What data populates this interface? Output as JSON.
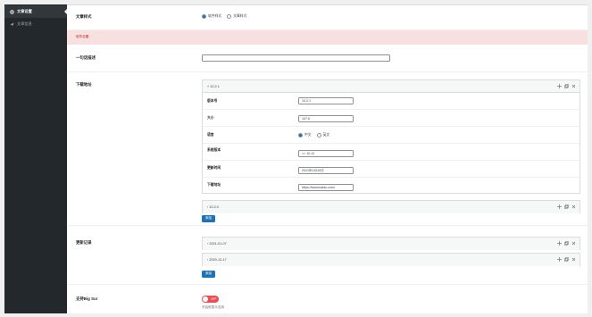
{
  "sidebar": {
    "items": [
      {
        "label": "文章设置",
        "icon": "gear-icon",
        "active": true
      },
      {
        "label": "文章信息",
        "icon": "paper-plane-icon",
        "active": false
      }
    ]
  },
  "main": {
    "article_style": {
      "label": "文章样式",
      "options": [
        {
          "label": "软件样式",
          "selected": true
        },
        {
          "label": "文章样式",
          "selected": false
        }
      ]
    },
    "notice": {
      "text": "软件设置"
    },
    "summary": {
      "label": "一句话描述",
      "value": ""
    },
    "download": {
      "label": "下载地址",
      "panels": [
        {
          "title": "10.2.1",
          "expanded": true,
          "fields": [
            {
              "label": "版本号",
              "type": "input",
              "value": "10.2.1"
            },
            {
              "label": "大小",
              "type": "input",
              "value": "107.6"
            },
            {
              "label": "语言",
              "type": "radio",
              "options": [
                {
                  "label": "中文",
                  "selected": true
                },
                {
                  "label": "英文",
                  "selected": false
                }
              ]
            },
            {
              "label": "系统版本",
              "type": "input",
              "value": ">= 10.12"
            },
            {
              "label": "更新时间",
              "type": "input",
              "value": "2021年1月10日"
            },
            {
              "label": "下载地址",
              "type": "input",
              "value": "https://www.baidu.com/"
            }
          ]
        },
        {
          "title": "10.2.0",
          "expanded": false
        }
      ],
      "add_label": "添加"
    },
    "changelog": {
      "label": "更新记录",
      "panels": [
        {
          "title": "2021-01-07"
        },
        {
          "title": "2020-12-17"
        }
      ],
      "add_label": "添加"
    },
    "big_sur": {
      "label": "支持Big Sur",
      "toggle_label": "OFF",
      "toggle_on": false,
      "hint": "开启即显示支持"
    }
  }
}
